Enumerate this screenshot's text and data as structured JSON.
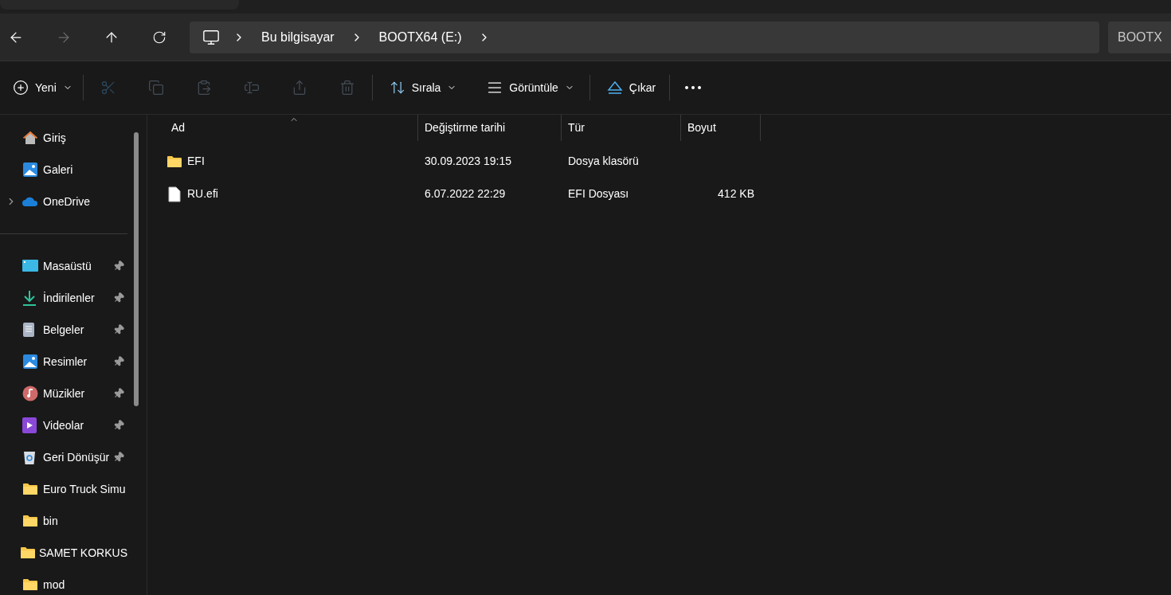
{
  "nav": {
    "back": {
      "disabled": false
    },
    "forward": {
      "disabled": true
    },
    "up": {
      "disabled": false
    },
    "breadcrumb": [
      "Bu bilgisayar",
      "BOOTX64 (E:)"
    ],
    "search": {
      "placeholder": "BOOTX"
    }
  },
  "toolbar": [
    {
      "kind": "new",
      "label": "Yeni",
      "disabled": false
    },
    {
      "kind": "separator"
    },
    {
      "kind": "cut",
      "disabled": true
    },
    {
      "kind": "copy",
      "disabled": true
    },
    {
      "kind": "paste",
      "disabled": true
    },
    {
      "kind": "rename",
      "disabled": true
    },
    {
      "kind": "share",
      "disabled": true
    },
    {
      "kind": "delete",
      "disabled": true
    },
    {
      "kind": "separator"
    },
    {
      "kind": "sort",
      "label": "Sırala",
      "disabled": false
    },
    {
      "kind": "view",
      "label": "Görüntüle",
      "disabled": false
    },
    {
      "kind": "separator"
    },
    {
      "kind": "eject",
      "label": "Çıkar",
      "disabled": false
    },
    {
      "kind": "separator"
    },
    {
      "kind": "more",
      "disabled": false
    }
  ],
  "sidebar": {
    "groups": [
      [
        {
          "kind": "home",
          "label": "Giriş",
          "pinned": false,
          "expandable": false
        },
        {
          "kind": "gallery",
          "label": "Galeri",
          "pinned": false,
          "expandable": false
        },
        {
          "kind": "cloud",
          "label": "OneDrive",
          "pinned": false,
          "expandable": true
        }
      ],
      [
        {
          "kind": "desktop",
          "label": "Masaüstü",
          "pinned": true,
          "expandable": false
        },
        {
          "kind": "download",
          "label": "İndirilenler",
          "pinned": true,
          "expandable": false
        },
        {
          "kind": "document",
          "label": "Belgeler",
          "pinned": true,
          "expandable": false
        },
        {
          "kind": "pictures",
          "label": "Resimler",
          "pinned": true,
          "expandable": false
        },
        {
          "kind": "music",
          "label": "Müzikler",
          "pinned": true,
          "expandable": false
        },
        {
          "kind": "video",
          "label": "Videolar",
          "pinned": true,
          "expandable": false
        },
        {
          "kind": "recycle",
          "label": "Geri Dönüşür",
          "pinned": true,
          "expandable": false
        },
        {
          "kind": "folder",
          "label": "Euro Truck Simu",
          "pinned": false,
          "expandable": false
        },
        {
          "kind": "folder",
          "label": "bin",
          "pinned": false,
          "expandable": false
        },
        {
          "kind": "folder",
          "label": "SAMET KORKUS",
          "pinned": false,
          "expandable": false
        },
        {
          "kind": "folder",
          "label": "mod",
          "pinned": false,
          "expandable": false
        }
      ]
    ]
  },
  "table": {
    "columns": [
      {
        "label": "Ad",
        "sorted": true
      },
      {
        "label": "Değiştirme tarihi",
        "sorted": false
      },
      {
        "label": "Tür",
        "sorted": false
      },
      {
        "label": "Boyut",
        "sorted": false
      }
    ],
    "rows": [
      {
        "kind": "folder",
        "name": "EFI",
        "date": "30.09.2023 19:15",
        "type": "Dosya klasörü"
      },
      {
        "kind": "file",
        "name": "RU.efi",
        "date": "6.07.2022 22:29",
        "type": "EFI Dosyası",
        "size": "412 KB"
      }
    ]
  }
}
